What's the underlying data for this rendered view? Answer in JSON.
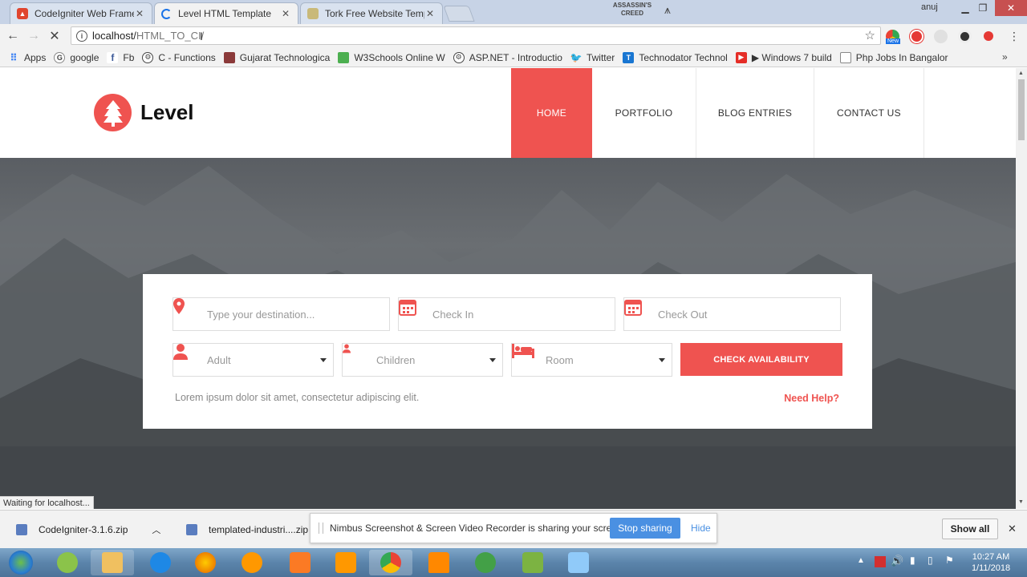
{
  "tabs": [
    {
      "title": "CodeIgniter Web Frame",
      "active": false
    },
    {
      "title": "Level HTML Template",
      "active": true
    },
    {
      "title": "Tork Free Website Temp",
      "active": false
    }
  ],
  "window": {
    "user": "anuj"
  },
  "address": {
    "host": "localhost/",
    "path": "HTML_TO_CI/"
  },
  "bookmarks": [
    {
      "label": "Apps",
      "icon": "apps-icon"
    },
    {
      "label": "google",
      "icon": "google-icon"
    },
    {
      "label": "Fb",
      "icon": "facebook-icon"
    },
    {
      "label": "C - Functions",
      "icon": "gear-icon"
    },
    {
      "label": "Gujarat Technologica",
      "icon": "university-icon"
    },
    {
      "label": "W3Schools Online W",
      "icon": "w3schools-icon"
    },
    {
      "label": "ASP.NET - Introductio",
      "icon": "gear-icon"
    },
    {
      "label": "Twitter",
      "icon": "twitter-icon"
    },
    {
      "label": "Technodator Technol",
      "icon": "technodator-icon"
    },
    {
      "label": "▶ Windows 7 build",
      "icon": "youtube-icon"
    },
    {
      "label": "Php Jobs In Bangalor",
      "icon": "page-icon"
    }
  ],
  "site": {
    "brand": "Level",
    "nav": [
      {
        "label": "HOME",
        "active": true
      },
      {
        "label": "PORTFOLIO",
        "active": false
      },
      {
        "label": "BLOG ENTRIES",
        "active": false
      },
      {
        "label": "CONTACT US",
        "active": false
      }
    ],
    "booking": {
      "destination_placeholder": "Type your destination...",
      "checkin_placeholder": "Check In",
      "checkout_placeholder": "Check Out",
      "adult": "Adult",
      "children": "Children",
      "room": "Room",
      "button": "CHECK AVAILABILITY",
      "note": "Lorem ipsum dolor sit amet, consectetur adipiscing elit.",
      "help": "Need Help?"
    }
  },
  "status": "Waiting for localhost...",
  "downloads": [
    {
      "name": "CodeIgniter-3.1.6.zip"
    },
    {
      "name": "templated-industri....zip"
    }
  ],
  "show_all": "Show all",
  "nimbus": {
    "message": "Nimbus Screenshot & Screen Video Recorder is sharing your screen.",
    "stop": "Stop sharing",
    "hide": "Hide"
  },
  "clock": {
    "time": "10:27 AM",
    "date": "1/11/2018"
  },
  "colors": {
    "accent": "#ef5350",
    "share_button": "#4a90e2"
  }
}
